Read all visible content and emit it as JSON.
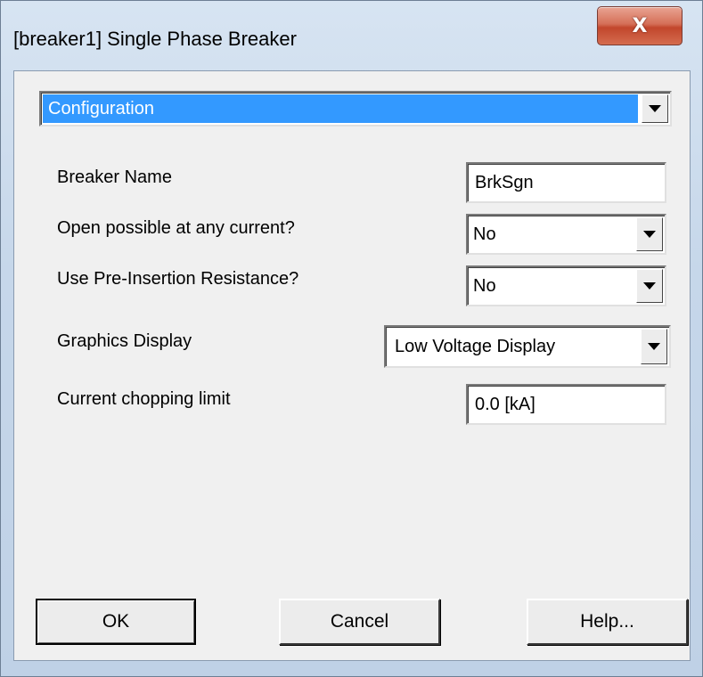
{
  "window": {
    "title": "[breaker1] Single Phase Breaker",
    "close_label": "X"
  },
  "section": {
    "selected": "Configuration"
  },
  "fields": {
    "breaker_name": {
      "label": "Breaker Name",
      "value": "BrkSgn"
    },
    "open_any_current": {
      "label": "Open possible at any current?",
      "value": "No"
    },
    "pre_insertion": {
      "label": "Use Pre-Insertion Resistance?",
      "value": "No"
    },
    "graphics_display": {
      "label": "Graphics Display",
      "value": "Low Voltage Display"
    },
    "chopping_limit": {
      "label": "Current chopping limit",
      "value": "0.0 [kA]"
    }
  },
  "buttons": {
    "ok": "OK",
    "cancel": "Cancel",
    "help": "Help..."
  },
  "colors": {
    "selection": "#3399ff",
    "close_button": "#c2462c",
    "dialog_face": "#f0f0f0"
  }
}
